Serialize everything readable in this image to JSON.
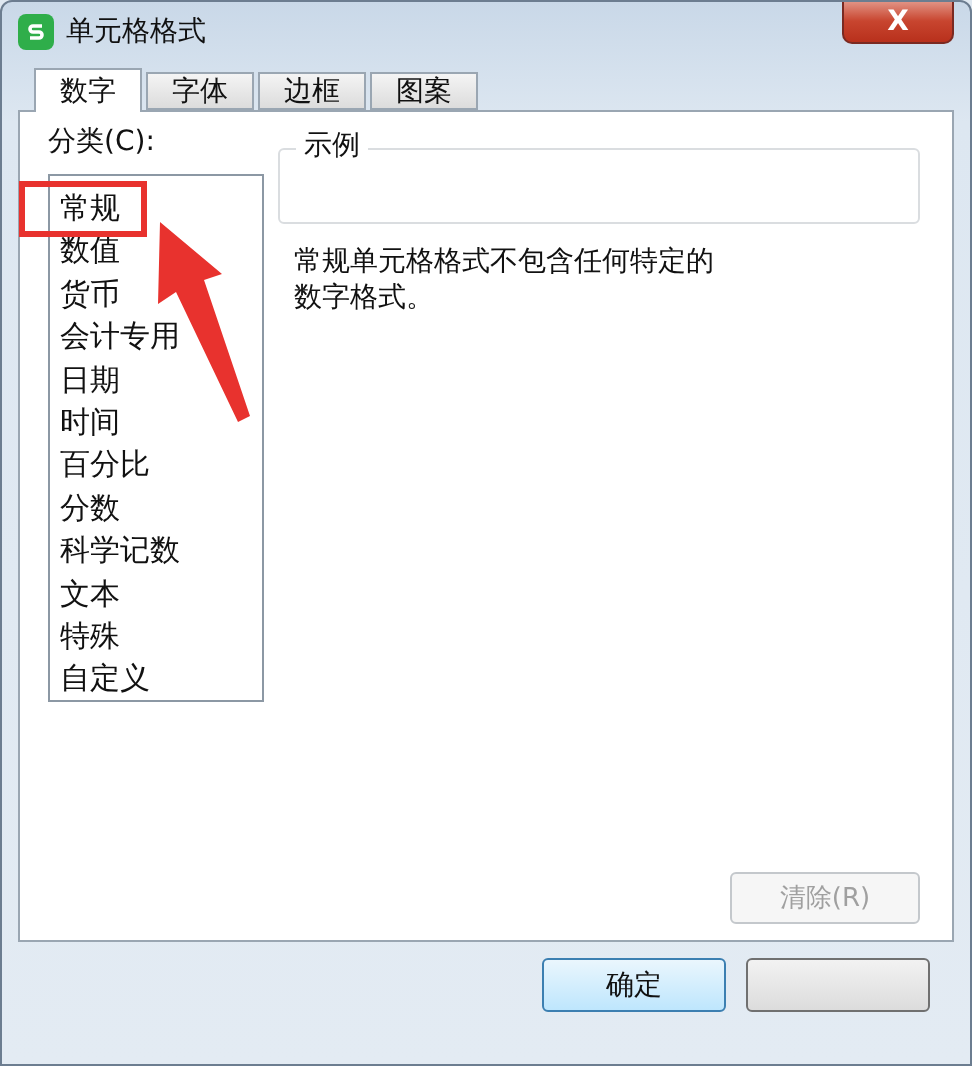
{
  "window": {
    "title": "单元格格式",
    "close_glyph": "X"
  },
  "tabs": [
    {
      "label": "数字",
      "selected": true
    },
    {
      "label": "字体",
      "selected": false
    },
    {
      "label": "边框",
      "selected": false
    },
    {
      "label": "图案",
      "selected": false
    }
  ],
  "category": {
    "label": "分类(C):",
    "items": [
      "常规",
      "数值",
      "货币",
      "会计专用",
      "日期",
      "时间",
      "百分比",
      "分数",
      "科学记数",
      "文本",
      "特殊",
      "自定义"
    ]
  },
  "sample": {
    "legend": "示例"
  },
  "description": "常规单元格格式不包含任何特定的数字格式。",
  "clear_button": {
    "label": "清除(R)",
    "disabled": true
  },
  "buttons": [
    {
      "label": "确定"
    }
  ]
}
